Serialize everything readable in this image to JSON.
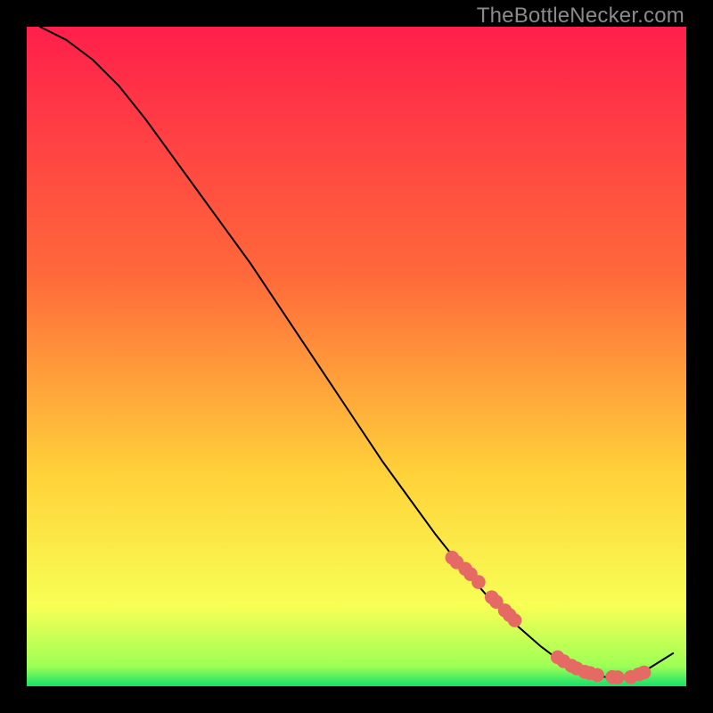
{
  "watermark": "TheBottleNecker.com",
  "colors": {
    "gradient_top": "#ff1f4b",
    "gradient_mid1": "#ff6a3a",
    "gradient_mid2": "#ffd23a",
    "gradient_low": "#f7ff55",
    "gradient_green": "#14e06b",
    "line": "#000000",
    "marker": "#e46a63",
    "bg": "#000000"
  },
  "chart_data": {
    "type": "line",
    "title": "",
    "xlabel": "",
    "ylabel": "",
    "xlim": [
      0,
      100
    ],
    "ylim": [
      0,
      100
    ],
    "grid": false,
    "legend": false,
    "series": [
      {
        "name": "curve",
        "x": [
          2,
          6,
          10,
          14,
          18,
          22,
          26,
          30,
          34,
          38,
          42,
          46,
          50,
          54,
          58,
          62,
          66,
          70,
          74,
          78,
          82,
          86,
          90,
          94,
          98
        ],
        "y": [
          100,
          98,
          95,
          91,
          86,
          80.5,
          75,
          69.5,
          64,
          58,
          52,
          46,
          40,
          34,
          28.5,
          23,
          18,
          13.5,
          9.5,
          6,
          3,
          1.5,
          1.3,
          2.5,
          5
        ]
      }
    ],
    "markers": {
      "name": "highlighted-points",
      "x": [
        64.5,
        65.2,
        66.5,
        67.3,
        68.5,
        70.5,
        71.2,
        72.5,
        73.2,
        74.0,
        80.5,
        81.4,
        82.6,
        83.4,
        84.6,
        85.4,
        86.5,
        88.8,
        89.6,
        91.6,
        92.8,
        93.6
      ],
      "y": [
        19.5,
        18.8,
        17.8,
        17.0,
        15.8,
        13.5,
        12.8,
        11.5,
        10.8,
        10.0,
        4.4,
        3.8,
        3.1,
        2.7,
        2.2,
        2.0,
        1.7,
        1.4,
        1.35,
        1.4,
        1.8,
        2.1
      ]
    }
  }
}
